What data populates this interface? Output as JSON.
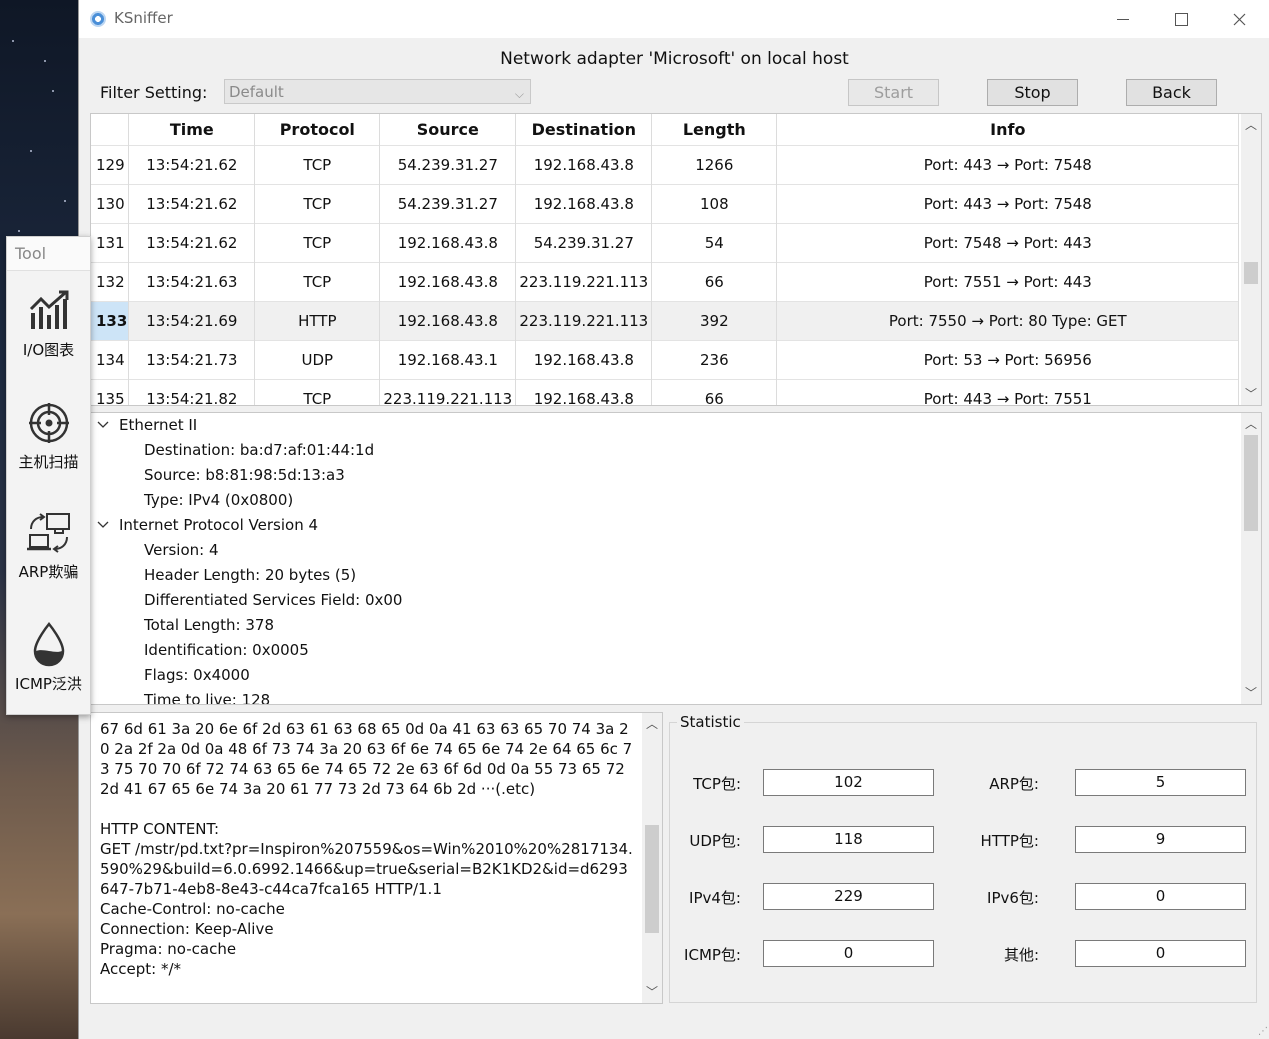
{
  "window": {
    "app_title": "KSniffer",
    "header_title": "Network adapter 'Microsoft' on local host"
  },
  "toolbar": {
    "filter_label": "Filter Setting:",
    "filter_value": "Default",
    "start_label": "Start",
    "stop_label": "Stop",
    "back_label": "Back"
  },
  "packet_table": {
    "columns": [
      "Time",
      "Protocol",
      "Source",
      "Destination",
      "Length",
      "Info"
    ],
    "selected_row": "133",
    "rows": [
      {
        "no": "129",
        "time": "13:54:21.62",
        "protocol": "TCP",
        "source": "54.239.31.27",
        "destination": "192.168.43.8",
        "length": "1266",
        "info": "Port: 443 → Port: 7548"
      },
      {
        "no": "130",
        "time": "13:54:21.62",
        "protocol": "TCP",
        "source": "54.239.31.27",
        "destination": "192.168.43.8",
        "length": "108",
        "info": "Port: 443 → Port: 7548"
      },
      {
        "no": "131",
        "time": "13:54:21.62",
        "protocol": "TCP",
        "source": "192.168.43.8",
        "destination": "54.239.31.27",
        "length": "54",
        "info": "Port: 7548 → Port: 443"
      },
      {
        "no": "132",
        "time": "13:54:21.63",
        "protocol": "TCP",
        "source": "192.168.43.8",
        "destination": "223.119.221.113",
        "length": "66",
        "info": "Port: 7551 → Port: 443"
      },
      {
        "no": "133",
        "time": "13:54:21.69",
        "protocol": "HTTP",
        "source": "192.168.43.8",
        "destination": "223.119.221.113",
        "length": "392",
        "info": "Port: 7550 → Port: 80   Type: GET"
      },
      {
        "no": "134",
        "time": "13:54:21.73",
        "protocol": "UDP",
        "source": "192.168.43.1",
        "destination": "192.168.43.8",
        "length": "236",
        "info": "Port: 53 → Port: 56956"
      },
      {
        "no": "135",
        "time": "13:54:21.82",
        "protocol": "TCP",
        "source": "223.119.221.113",
        "destination": "192.168.43.8",
        "length": "66",
        "info": "Port: 443 → Port: 7551"
      }
    ]
  },
  "details_tree": {
    "ethernet": {
      "title": "Ethernet II",
      "destination": "Destination: ba:d7:af:01:44:1d",
      "source": "Source: b8:81:98:5d:13:a3",
      "type": "Type: IPv4 (0x0800)"
    },
    "ip": {
      "title": "Internet Protocol Version 4",
      "version": "Version: 4",
      "header_length": "Header Length: 20 bytes (5)",
      "dsf": "Differentiated Services Field: 0x00",
      "total_length": "Total Length: 378",
      "identification": "Identification: 0x0005",
      "flags": "Flags: 0x4000",
      "ttl": "Time to live: 128"
    }
  },
  "hex_pane": {
    "content": "67 6d 61 3a 20 6e 6f 2d 63 61 63 68 65 0d 0a 41 63 63 65 70 74 3a 20 2a 2f 2a 0d 0a 48 6f 73 74 3a 20 63 6f 6e 74 65 6e 74 2e 64 65 6c 73 75 70 70 6f 72 74 63 65 6e 74 65 72 2e 63 6f 6d 0d 0a 55 73 65 72 2d 41 67 65 6e 74 3a 20 61 77 73 2d 73 64 6b 2d ···(.etc)\n\nHTTP CONTENT:\nGET /mstr/pd.txt?pr=Inspiron%207559&os=Win%2010%20%2817134.590%29&build=6.0.6992.1466&up=true&serial=B2K1KD2&id=d6293647-7b71-4eb8-8e43-c44ca7fca165 HTTP/1.1\nCache-Control: no-cache\nConnection: Keep-Alive\nPragma: no-cache\nAccept: */*"
  },
  "statistic": {
    "title": "Statistic",
    "tcp_label": "TCP包:",
    "tcp_value": "102",
    "arp_label": "ARP包:",
    "arp_value": "5",
    "udp_label": "UDP包:",
    "udp_value": "118",
    "http_label": "HTTP包:",
    "http_value": "9",
    "ipv4_label": "IPv4包:",
    "ipv4_value": "229",
    "ipv6_label": "IPv6包:",
    "ipv6_value": "0",
    "icmp_label": "ICMP包:",
    "icmp_value": "0",
    "other_label": "其他:",
    "other_value": "0"
  },
  "tool_panel": {
    "title": "Tool",
    "io_chart_label": "I/O图表",
    "host_scan_label": "主机扫描",
    "arp_spoof_label": "ARP欺骗",
    "icmp_flood_label": "ICMP泛洪"
  }
}
